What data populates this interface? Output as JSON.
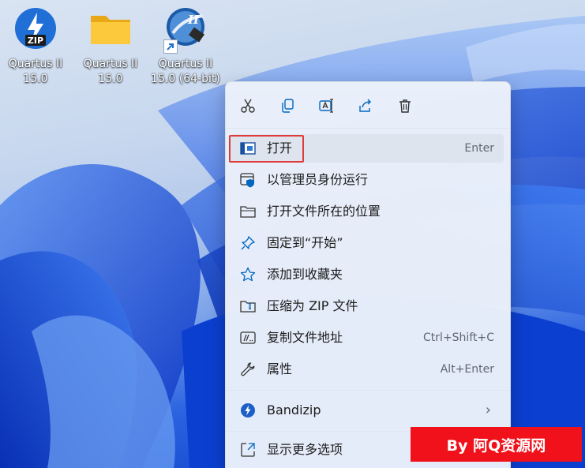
{
  "desktop": {
    "icons": [
      {
        "name": "quartus-zip",
        "line1": "Quartus II",
        "line2": "15.0",
        "icon": "zip-archive-icon"
      },
      {
        "name": "quartus-folder",
        "line1": "Quartus II",
        "line2": "15.0",
        "icon": "folder-icon"
      },
      {
        "name": "quartus-64",
        "line1": "Quartus II",
        "line2": "15.0 (64-bit)",
        "icon": "quartus-app-icon"
      }
    ],
    "zip_badge": "ZIP",
    "app_badge": "II"
  },
  "context_menu": {
    "quick_actions": [
      {
        "name": "cut-icon",
        "label": "Cut"
      },
      {
        "name": "copy-icon",
        "label": "Copy"
      },
      {
        "name": "rename-icon",
        "label": "Rename"
      },
      {
        "name": "share-icon",
        "label": "Share"
      },
      {
        "name": "delete-icon",
        "label": "Delete"
      }
    ],
    "items": [
      {
        "label": "打开",
        "shortcut": "Enter",
        "icon": "open-window-icon",
        "highlighted": true
      },
      {
        "label": "以管理员身份运行",
        "shortcut": "",
        "icon": "admin-shield-icon"
      },
      {
        "label": "打开文件所在的位置",
        "shortcut": "",
        "icon": "folder-outline-icon"
      },
      {
        "label": "固定到“开始”",
        "shortcut": "",
        "icon": "pin-icon"
      },
      {
        "label": "添加到收藏夹",
        "shortcut": "",
        "icon": "star-icon"
      },
      {
        "label": "压缩为 ZIP 文件",
        "shortcut": "",
        "icon": "zip-folder-icon"
      },
      {
        "label": "复制文件地址",
        "shortcut": "Ctrl+Shift+C",
        "icon": "copy-path-icon"
      },
      {
        "label": "属性",
        "shortcut": "Alt+Enter",
        "icon": "wrench-icon"
      }
    ],
    "bandizip": {
      "label": "Bandizip",
      "icon": "bandizip-icon",
      "submenu": "›"
    },
    "more": {
      "label": "显示更多选项",
      "icon": "more-options-icon"
    }
  },
  "watermark": "By 阿Q资源网",
  "colors": {
    "highlight_border": "#e03b3b",
    "watermark_bg": "#f0111a",
    "accent_blue": "#0067c0"
  }
}
